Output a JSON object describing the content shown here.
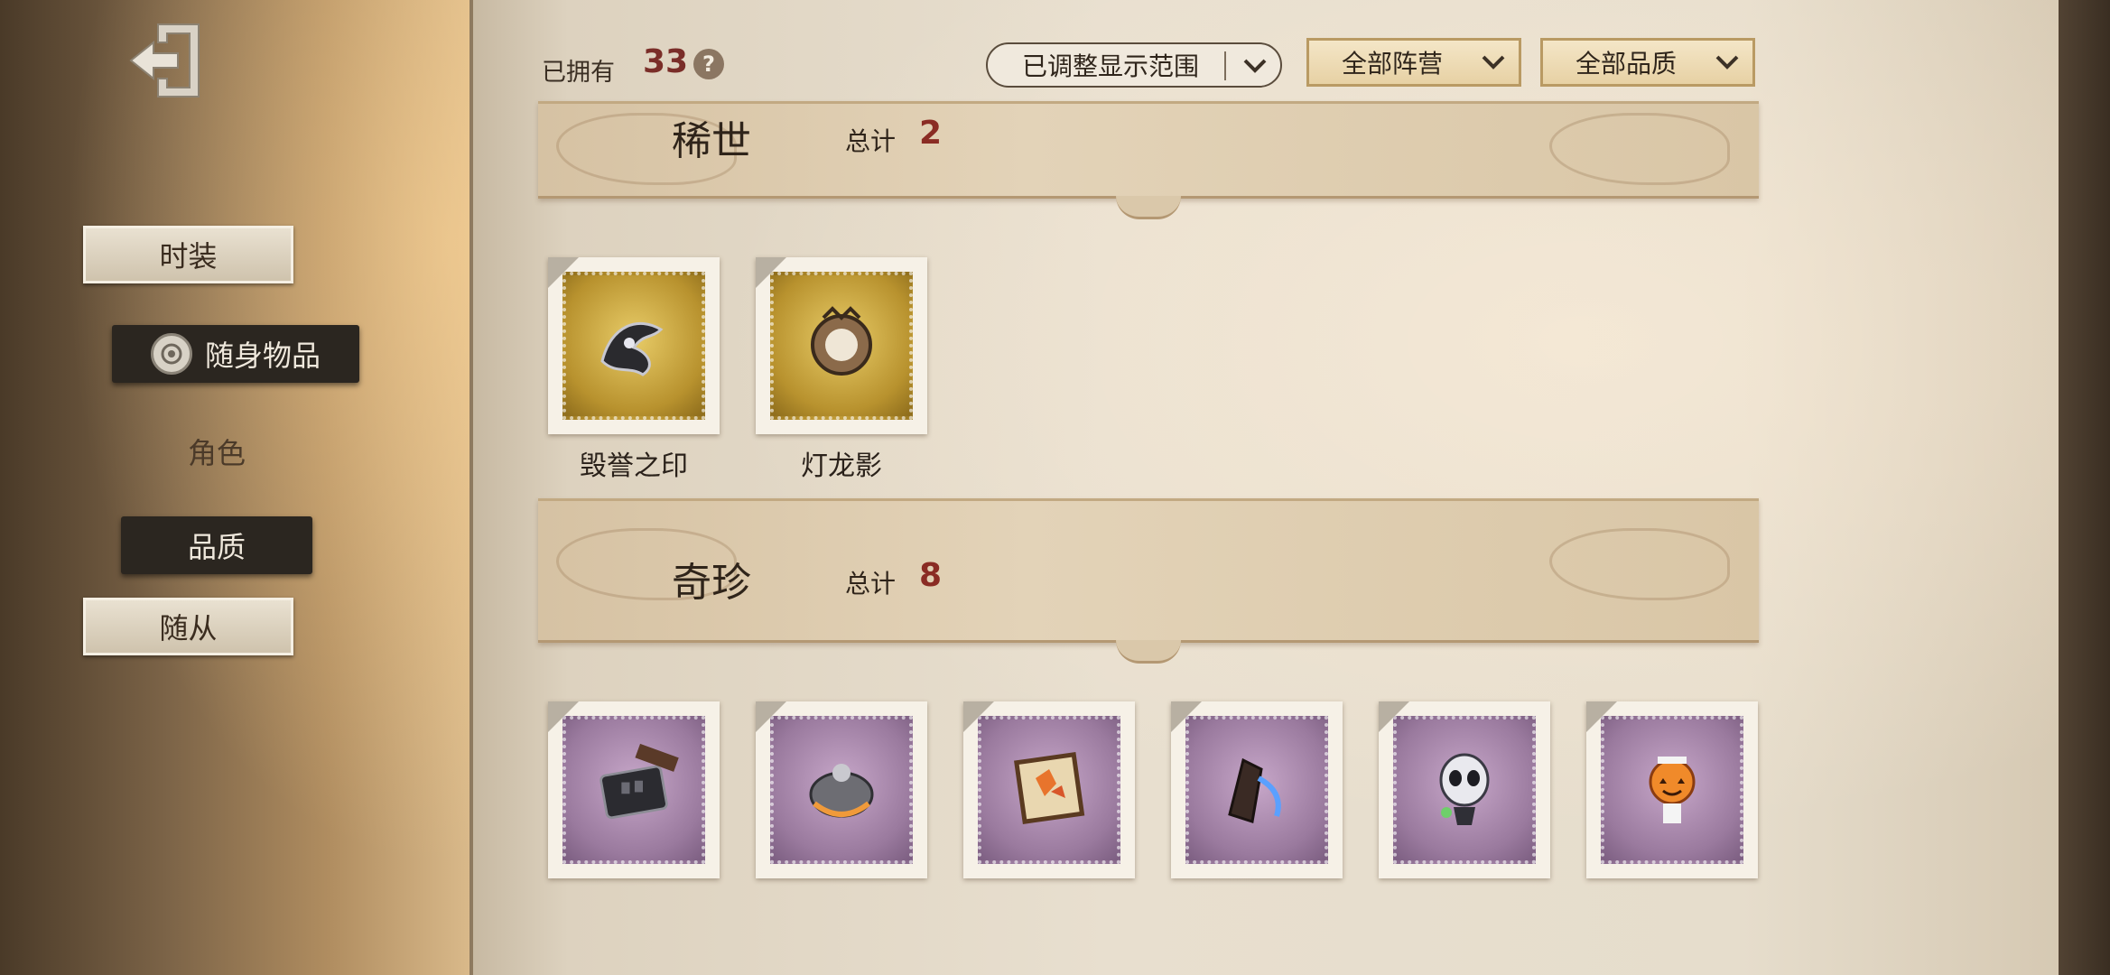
{
  "sidebar": {
    "items": [
      {
        "label": "时装",
        "style": "paper"
      },
      {
        "label": "随身物品",
        "style": "dark-selected"
      },
      {
        "label": "角色",
        "style": "plain"
      },
      {
        "label": "品质",
        "style": "dark"
      },
      {
        "label": "随从",
        "style": "paper"
      }
    ]
  },
  "header": {
    "owned_label": "已拥有",
    "owned_count": "33",
    "help_icon": "?",
    "filters": {
      "range": "已调整显示范围",
      "camp": "全部阵营",
      "quality": "全部品质"
    }
  },
  "sections": [
    {
      "title": "稀世",
      "total_label": "总计",
      "total": "2",
      "items": [
        {
          "label": "毁誉之印",
          "color": "gold"
        },
        {
          "label": "灯龙影",
          "color": "gold"
        }
      ]
    },
    {
      "title": "奇珍",
      "total_label": "总计",
      "total": "8",
      "items": [
        {
          "label": "",
          "color": "purple"
        },
        {
          "label": "",
          "color": "purple"
        },
        {
          "label": "",
          "color": "purple"
        },
        {
          "label": "",
          "color": "purple"
        },
        {
          "label": "",
          "color": "purple"
        },
        {
          "label": "",
          "color": "purple"
        }
      ]
    }
  ],
  "colors": {
    "accent_red": "#8a2c24",
    "gold_stamp": "#c9a543",
    "purple_stamp": "#9a7a9e"
  }
}
